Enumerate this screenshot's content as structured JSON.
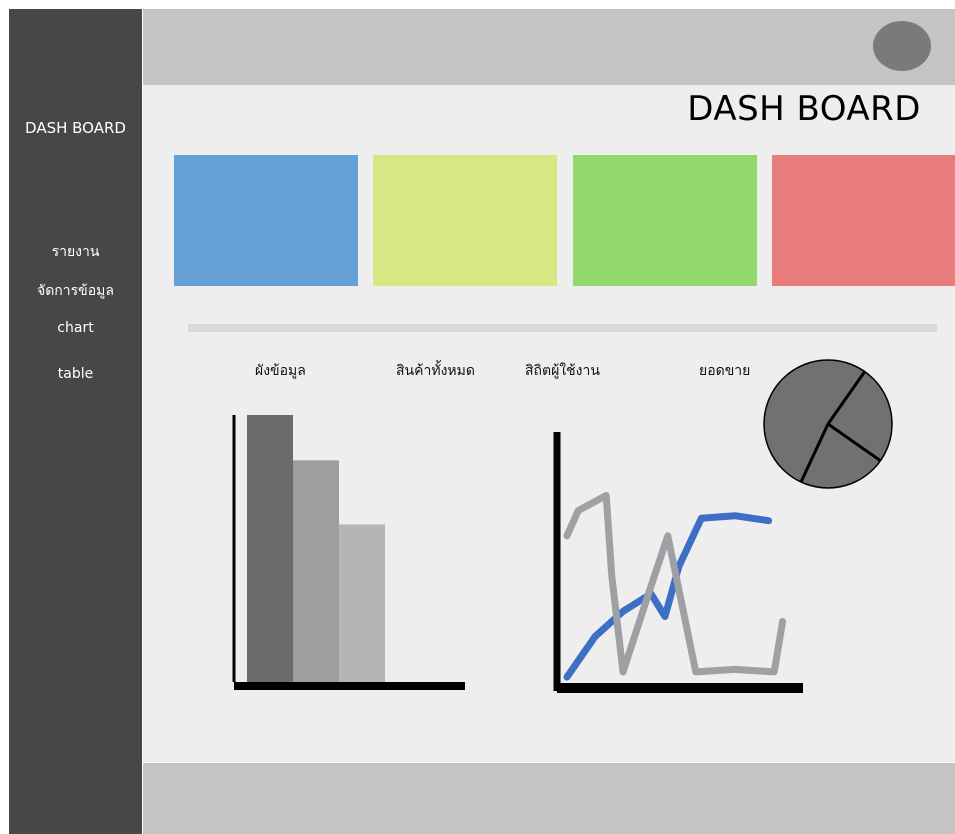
{
  "sidebar": {
    "brand": "DASH BOARD",
    "items": [
      {
        "label": "รายงาน"
      },
      {
        "label": "จัดการข้อมูล"
      },
      {
        "label": "chart"
      },
      {
        "label": "table"
      }
    ]
  },
  "header": {
    "title": "DASH BOARD",
    "avatar_icon": "user-avatar-circle"
  },
  "cards": [
    {
      "color": "#65a1d7"
    },
    {
      "color": "#d8e683"
    },
    {
      "color": "#91d96e"
    },
    {
      "color": "#e87b7b"
    }
  ],
  "chart_labels": [
    "ผังข้อมูล",
    "สินค้าทั้งหมด",
    "สิถิตผู้ใช้งาน",
    "ยอดขาย"
  ],
  "chart_data": [
    {
      "type": "bar",
      "categories": [
        "",
        "",
        ""
      ],
      "values": [
        100,
        83,
        59
      ],
      "colors": [
        "#6b6b6b",
        "#9e9e9e",
        "#b5b5b5"
      ],
      "ylim": [
        0,
        100
      ]
    },
    {
      "type": "line",
      "series": [
        {
          "color": "#3d6fc4",
          "values": [
            [
              0,
              2
            ],
            [
              10,
              18
            ],
            [
              20,
              28
            ],
            [
              30,
              35
            ],
            [
              35,
              26
            ],
            [
              40,
              46
            ],
            [
              48,
              65
            ],
            [
              60,
              66
            ],
            [
              72,
              64
            ]
          ]
        },
        {
          "color": "#9ea0a3",
          "values": [
            [
              0,
              58
            ],
            [
              4,
              68
            ],
            [
              14,
              74
            ],
            [
              16,
              42
            ],
            [
              20,
              4
            ],
            [
              30,
              38
            ],
            [
              36,
              58
            ],
            [
              46,
              4
            ],
            [
              60,
              5
            ],
            [
              74,
              4
            ],
            [
              77,
              24
            ]
          ]
        }
      ],
      "xlim": [
        0,
        80
      ],
      "ylim": [
        0,
        100
      ]
    },
    {
      "type": "pie",
      "slice_boundaries_deg": [
        35,
        125,
        205
      ],
      "fill": "#727070"
    }
  ]
}
